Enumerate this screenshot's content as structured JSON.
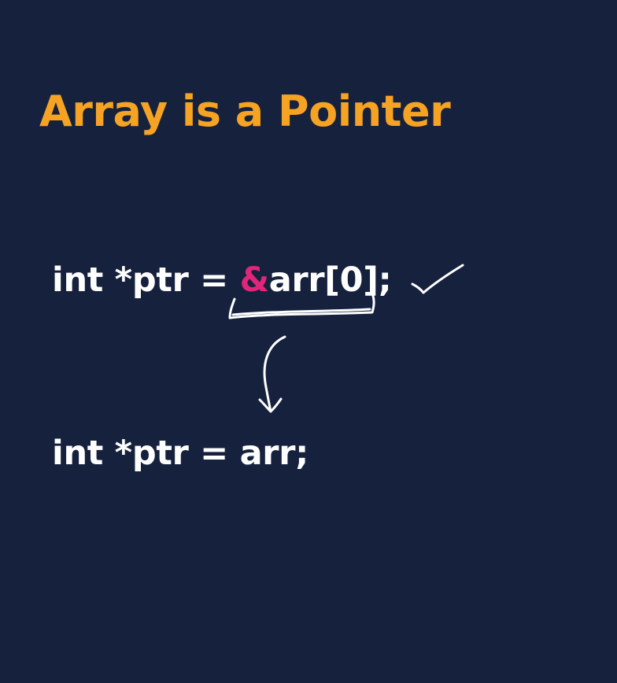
{
  "slide": {
    "title": "Array is a Pointer",
    "line1": {
      "before": "int *ptr = ",
      "highlight": "&",
      "after": "arr[0];"
    },
    "line2": "int *ptr = arr;"
  },
  "colors": {
    "background": "#16223d",
    "title": "#f6a324",
    "code_text": "#ffffff",
    "highlight": "#e0257a",
    "handwriting": "#ffffff"
  },
  "annotations": {
    "check_icon": "checkmark-icon",
    "bracket_icon": "underline-bracket-icon",
    "arrow_icon": "down-arrow-icon"
  }
}
